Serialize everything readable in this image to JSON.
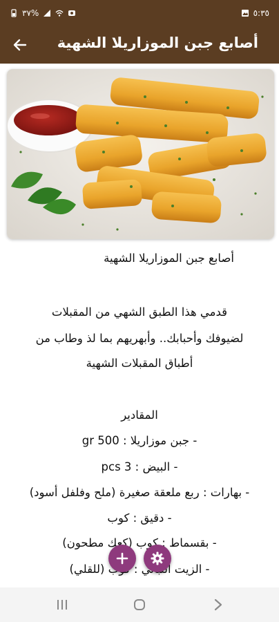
{
  "status_bar": {
    "time": "٥:٣٥",
    "battery": "٣٧%"
  },
  "app_bar": {
    "title": "أصابع جبن الموزاريلا الشهية"
  },
  "hero": {
    "alt": "mozzarella-sticks-photo"
  },
  "recipe": {
    "title": "أصابع جبن الموزاريلا الشهية",
    "intro_lines": [
      "قدمي هذا الطبق الشهي من المقبلات",
      "لضيوفك وأحبابك.. وأبهريهم بما لذ وطاب من",
      "أطباق المقبلات الشهية"
    ],
    "ingredients_heading": "المقادير",
    "ingredients": [
      "- جبن موزاريلا : gr 500",
      "- البيض : pcs 3",
      "- بهارات : ربع ملعقة صغيرة (ملح وفلفل أسود)",
      "- دقيق : كوب",
      "- بقسماط : كوب (كعك مطحون)",
      "- الزيت النباتي : كوب (للقلي)"
    ]
  },
  "fab": {
    "add_icon": "plus-icon",
    "settings_icon": "gear-icon"
  },
  "colors": {
    "app_bar": "#5b3d22",
    "fab": "#8e3a7d"
  }
}
